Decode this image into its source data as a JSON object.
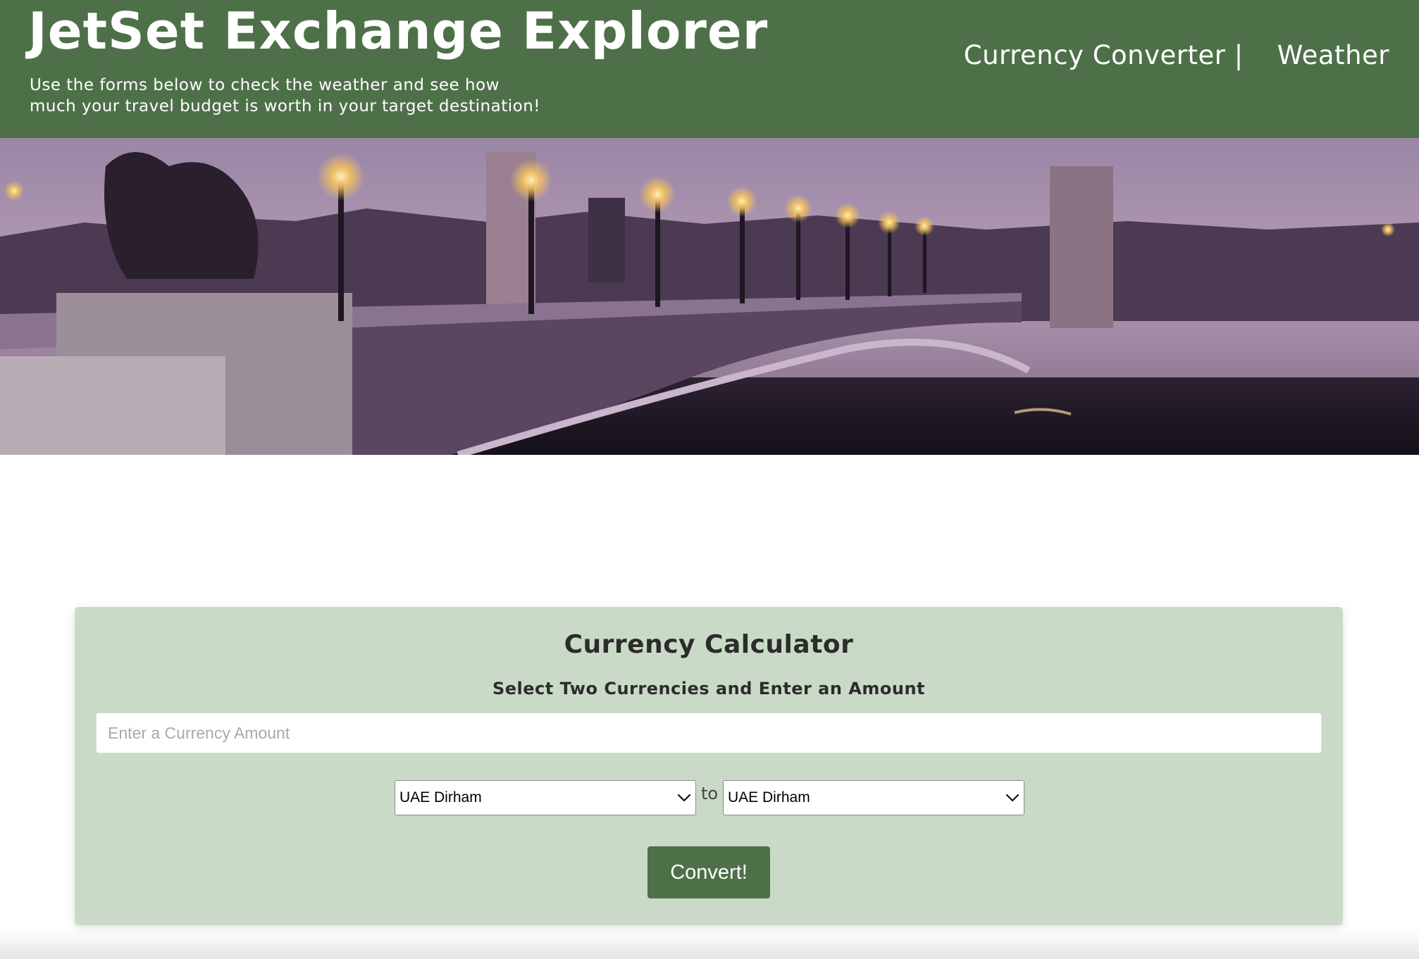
{
  "header": {
    "title": "JetSet Exchange Explorer",
    "tagline_line1": "Use the forms below to check the weather and see how",
    "tagline_line2": "much your travel budget is worth in your target destination!",
    "nav": {
      "currency_converter": "Currency Converter |",
      "weather": "Weather"
    }
  },
  "hero": {
    "image_alt": "Night view of an ornate bridge with lit lamp posts over a river"
  },
  "calculator": {
    "title": "Currency Calculator",
    "subtitle": "Select Two Currencies and Enter an Amount",
    "amount_placeholder": "Enter a Currency Amount",
    "amount_value": "",
    "from_currency": "UAE Dirham",
    "to_label": "to",
    "to_currency": "UAE Dirham",
    "convert_label": "Convert!"
  },
  "colors": {
    "header_bg": "#4e7049",
    "card_bg": "#c9dbc6",
    "button_bg": "#4e7049"
  }
}
